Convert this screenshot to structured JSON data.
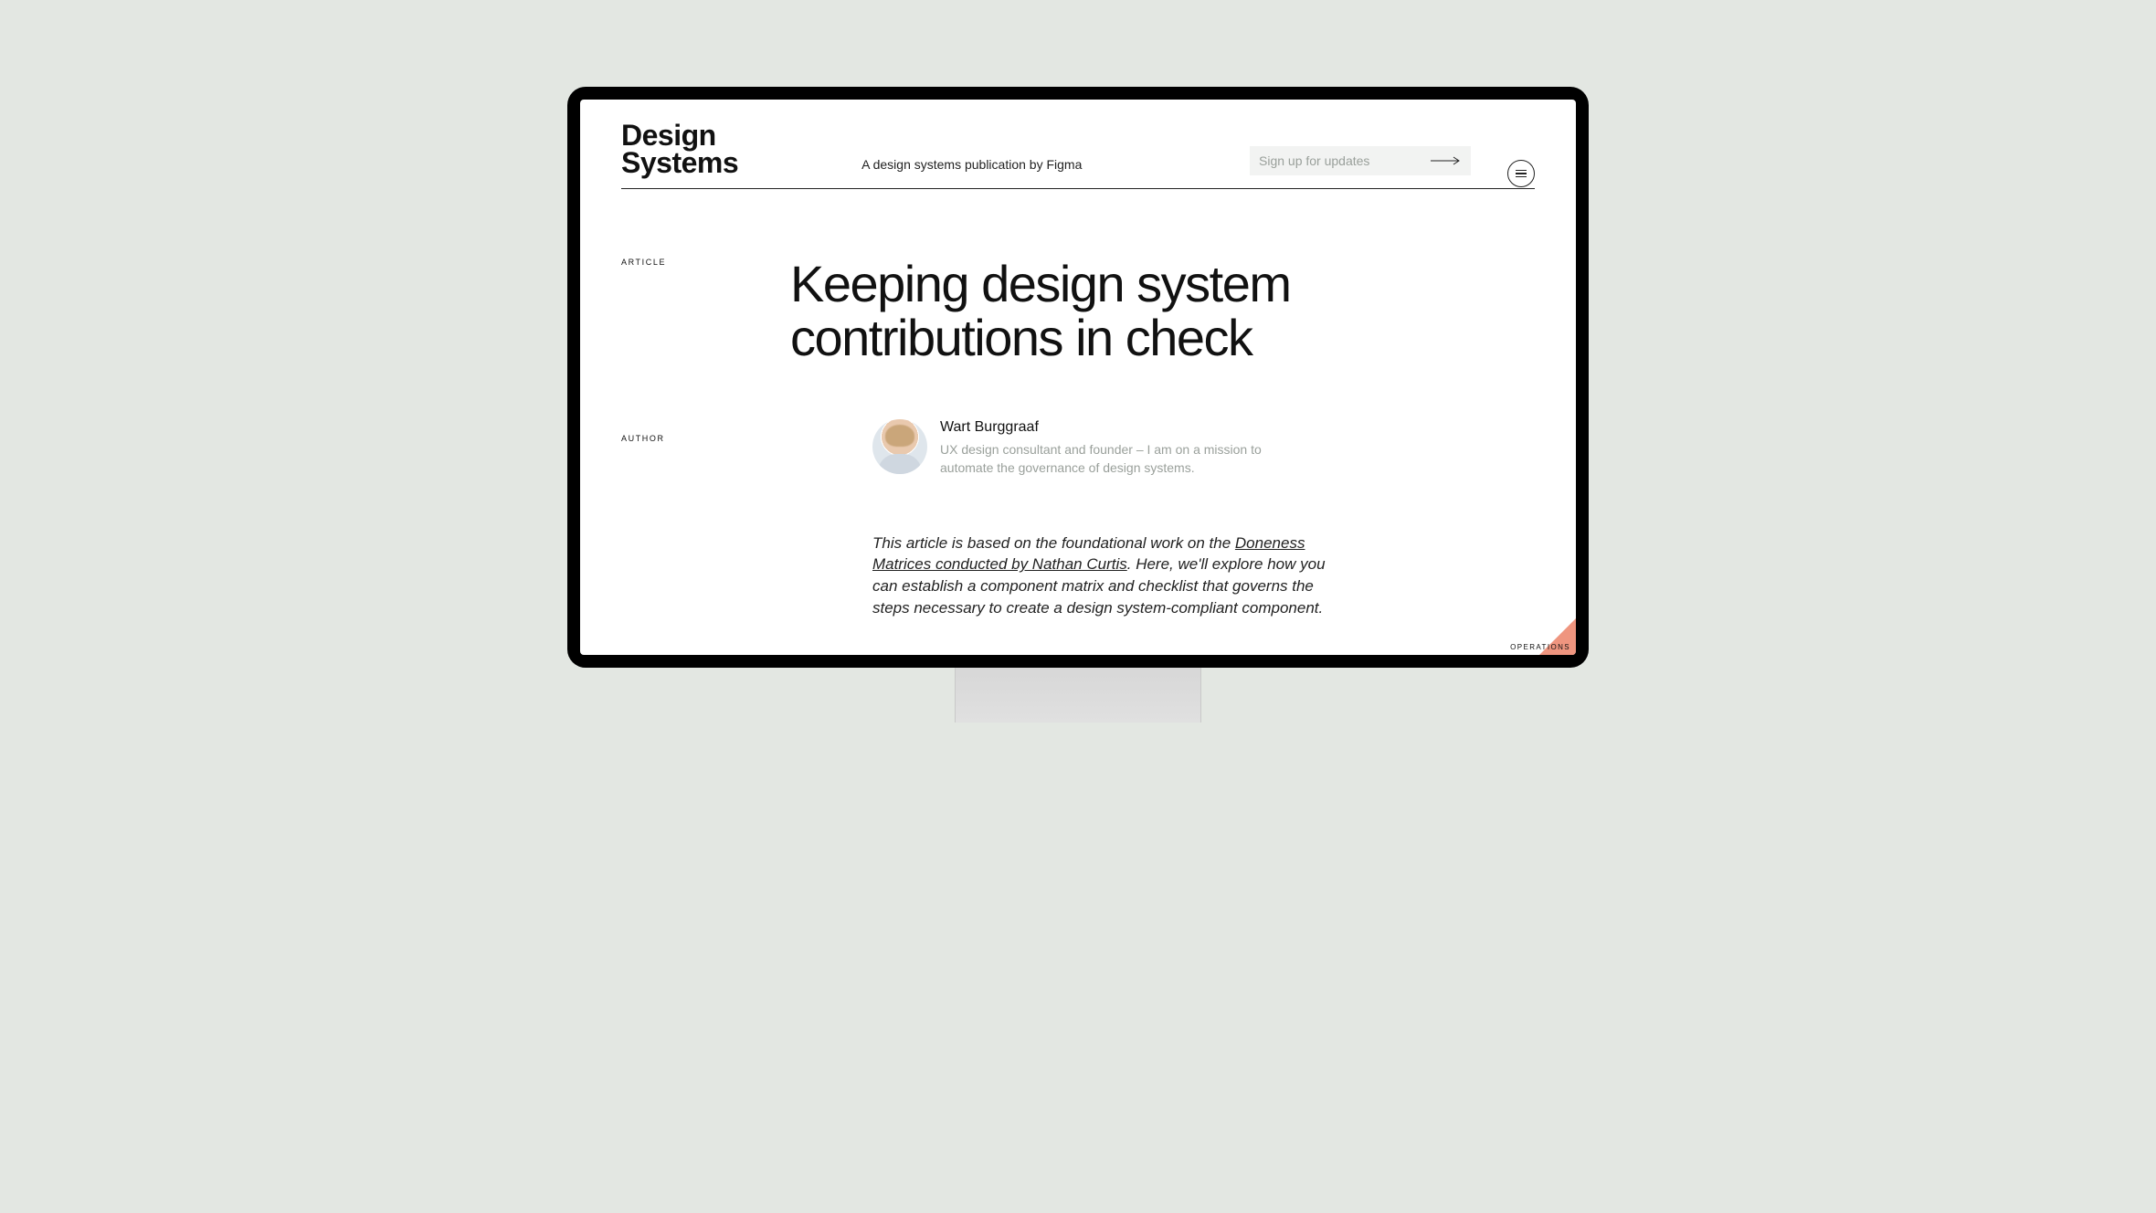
{
  "header": {
    "logo_line1": "Design",
    "logo_line2": "Systems",
    "tagline": "A design systems publication by Figma",
    "signup_placeholder": "Sign up for updates"
  },
  "labels": {
    "article": "ARTICLE",
    "author": "AUTHOR"
  },
  "article": {
    "title": "Keeping design system contributions in check",
    "author_name": "Wart Burggraaf",
    "author_bio": "UX design consultant and founder – I am on a mission to automate the governance of design systems.",
    "intro_prefix": "This article is based on the foundational work on the ",
    "intro_link": "Doneness Matrices conducted by Nathan Curtis",
    "intro_suffix": ". Here, we'll explore how you can establish a component matrix and checklist that governs the steps necessary to create a design system-compliant component."
  },
  "corner": {
    "label": "OPERATIONS"
  }
}
